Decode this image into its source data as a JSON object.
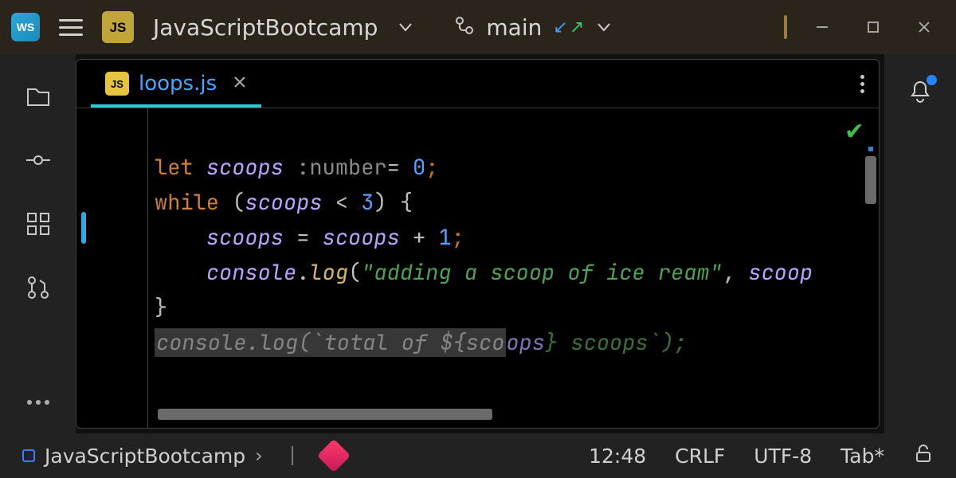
{
  "titlebar": {
    "project_badge": "JS",
    "project_name": "JavaScriptBootcamp",
    "branch": "main"
  },
  "tabs": [
    {
      "badge": "JS",
      "name": "loops.js",
      "active": true
    }
  ],
  "code": {
    "line1_kw": "let",
    "line1_ident": "scoops",
    "line1_hint": ":number",
    "line1_eq": "=",
    "line1_num": "0",
    "line1_semicol": ";",
    "line2_kw": "while",
    "line2_open": "(",
    "line2_ident": "scoops",
    "line2_lt": " < ",
    "line2_num": "3",
    "line2_close": ")",
    "line2_brace": " {",
    "line3_ident": "scoops",
    "line3_eq": " = ",
    "line3_ident2": "scoops",
    "line3_plus": " + ",
    "line3_num": "1",
    "line3_semicol": ";",
    "line4_obj": "console",
    "line4_dot": ".",
    "line4_meth": "log",
    "line4_open": "(",
    "line4_str": "\"adding a scoop of ice ream\"",
    "line4_comma": ", ",
    "line4_ident": "scoop",
    "line5_brace": "}",
    "line6_prefix_hl": "console.log(`total of ${sco",
    "line6_mid": "ops",
    "line6_close": "} scoops`);"
  },
  "status": {
    "project": "JavaScriptBootcamp",
    "cursor": "12:48",
    "line_sep": "CRLF",
    "encoding": "UTF-8",
    "indent": "Tab*"
  }
}
